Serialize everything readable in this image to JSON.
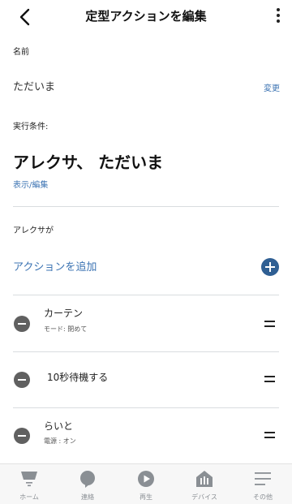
{
  "header": {
    "title": "定型アクションを編集"
  },
  "name_section": {
    "label": "名前",
    "value": "ただいま",
    "change_link": "変更"
  },
  "trigger_section": {
    "label": "実行条件:",
    "phrase": "アレクサ、 ただいま",
    "view_edit_link": "表示/編集"
  },
  "actions_section": {
    "label": "アレクサが",
    "add_action": "アクションを追加",
    "items": [
      {
        "title": "カーテン",
        "subtitle": "モード: 閉めて"
      },
      {
        "title": "10秒待機する",
        "subtitle": ""
      },
      {
        "title": "らいと",
        "subtitle": "電源 : オン"
      }
    ]
  },
  "tabbar": {
    "items": [
      {
        "label": "ホーム",
        "icon": "home-icon"
      },
      {
        "label": "連絡",
        "icon": "chat-bubble-icon"
      },
      {
        "label": "再生",
        "icon": "play-icon"
      },
      {
        "label": "デバイス",
        "icon": "devices-house-icon"
      },
      {
        "label": "その他",
        "icon": "menu-icon"
      }
    ]
  },
  "colors": {
    "accent": "#3d74b3",
    "add_button": "#2f5f93",
    "remove_icon": "#606060",
    "tab_icon": "#8a8f94"
  }
}
